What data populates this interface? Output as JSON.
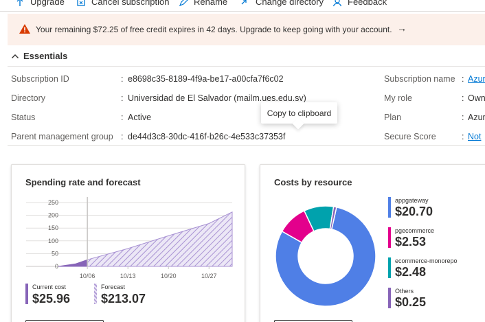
{
  "toolbar": {
    "items": [
      {
        "label": "Upgrade",
        "icon": "upgrade-icon"
      },
      {
        "label": "Cancel subscription",
        "icon": "cancel-subscription-icon"
      },
      {
        "label": "Rename",
        "icon": "rename-icon"
      },
      {
        "label": "Change directory",
        "icon": "change-directory-icon"
      },
      {
        "label": "Feedback",
        "icon": "feedback-icon"
      }
    ]
  },
  "banner": {
    "message": "Your remaining $72.25 of free credit expires in 42 days. Upgrade to keep going with your account.",
    "arrow": "→",
    "warning_color": "#d83b01"
  },
  "essentials": {
    "title": "Essentials",
    "left": [
      {
        "label": "Subscription ID",
        "value": "e8698c35-8189-4f9a-be17-a00cfa7f6c02"
      },
      {
        "label": "Directory",
        "value": "Universidad de El Salvador (mailm.ues.edu.sv)"
      },
      {
        "label": "Status",
        "value": "Active"
      },
      {
        "label": "Parent management group",
        "value": "de44d3c8-30dc-416f-b26c-4e533c37353f"
      }
    ],
    "right": [
      {
        "label": "Subscription name",
        "value": "Azur",
        "link": true
      },
      {
        "label": "My role",
        "value": "Own",
        "link": false
      },
      {
        "label": "Plan",
        "value": "Azur",
        "link": false
      },
      {
        "label": "Secure Score",
        "value": "Not",
        "link": true
      }
    ],
    "colon": ":"
  },
  "tooltip": {
    "text": "Copy to clipboard"
  },
  "spending": {
    "title": "Spending rate and forecast",
    "current_label": "Current cost",
    "current_value": "$25.96",
    "current_color": "#8764b8",
    "forecast_label": "Forecast",
    "forecast_value": "$213.07",
    "forecast_color": "#b4a0d8"
  },
  "costs": {
    "title": "Costs by resource",
    "items": [
      {
        "name": "appgateway",
        "value": "$20.70",
        "color": "#4f7fe6"
      },
      {
        "name": "pgecommerce",
        "value": "$2.53",
        "color": "#e3008c"
      },
      {
        "name": "ecommerce-monorepo",
        "value": "$2.48",
        "color": "#00a2ad"
      },
      {
        "name": "Others",
        "value": "$0.25",
        "color": "#8764b8"
      }
    ]
  },
  "chart_data": [
    {
      "type": "area",
      "title": "Spending rate and forecast",
      "xlabel": "",
      "ylabel": "",
      "y_ticks": [
        0,
        50,
        100,
        150,
        200,
        250
      ],
      "x_ticks": [
        "10/06",
        "10/13",
        "10/20",
        "10/27"
      ],
      "ylim": [
        0,
        250
      ],
      "grid": true,
      "series": [
        {
          "name": "Current cost",
          "x": [
            "10/01",
            "10/04",
            "10/06"
          ],
          "y": [
            0,
            10,
            26
          ],
          "style": "solid"
        },
        {
          "name": "Forecast",
          "x": [
            "10/06",
            "10/13",
            "10/20",
            "10/27",
            "10/31"
          ],
          "y": [
            26,
            70,
            120,
            168,
            213
          ],
          "style": "hatched"
        }
      ]
    },
    {
      "type": "pie",
      "title": "Costs by resource",
      "categories": [
        "appgateway",
        "pgecommerce",
        "ecommerce-monorepo",
        "Others"
      ],
      "values": [
        20.7,
        2.53,
        2.48,
        0.25
      ]
    }
  ]
}
